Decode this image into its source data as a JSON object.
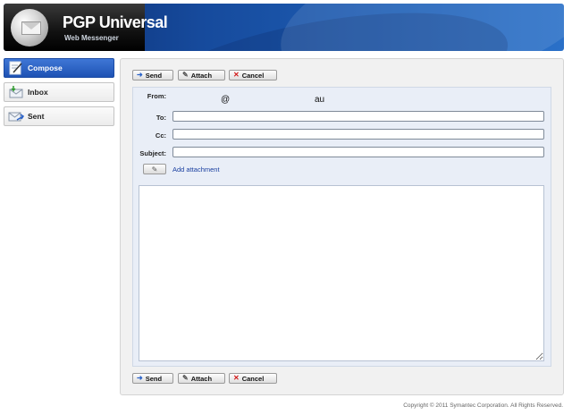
{
  "header": {
    "title": "PGP Universal",
    "subtitle": "Web Messenger"
  },
  "sidebar": {
    "items": [
      {
        "label": "Compose",
        "icon": "compose-icon",
        "active": true
      },
      {
        "label": "Inbox",
        "icon": "inbox-icon",
        "active": false
      },
      {
        "label": "Sent",
        "icon": "sent-icon",
        "active": false
      }
    ]
  },
  "toolbar": {
    "send_label": "Send",
    "attach_label": "Attach",
    "cancel_label": "Cancel"
  },
  "form": {
    "from_label": "From:",
    "from_value_1": "@",
    "from_value_2": "au",
    "to_label": "To:",
    "to_value": "",
    "cc_label": "Cc:",
    "cc_value": "",
    "subject_label": "Subject:",
    "subject_value": "",
    "add_attachment_label": "Add attachment",
    "body_value": ""
  },
  "footer": {
    "copyright": "Copyright © 2011 Symantec Corporation. All Rights Reserved."
  },
  "colors": {
    "header_blue": "#1e5fb6",
    "active_nav": "#2a62c8",
    "form_bg": "#e9eef7",
    "link": "#1a3fa0",
    "cancel_red": "#d21a1a"
  }
}
